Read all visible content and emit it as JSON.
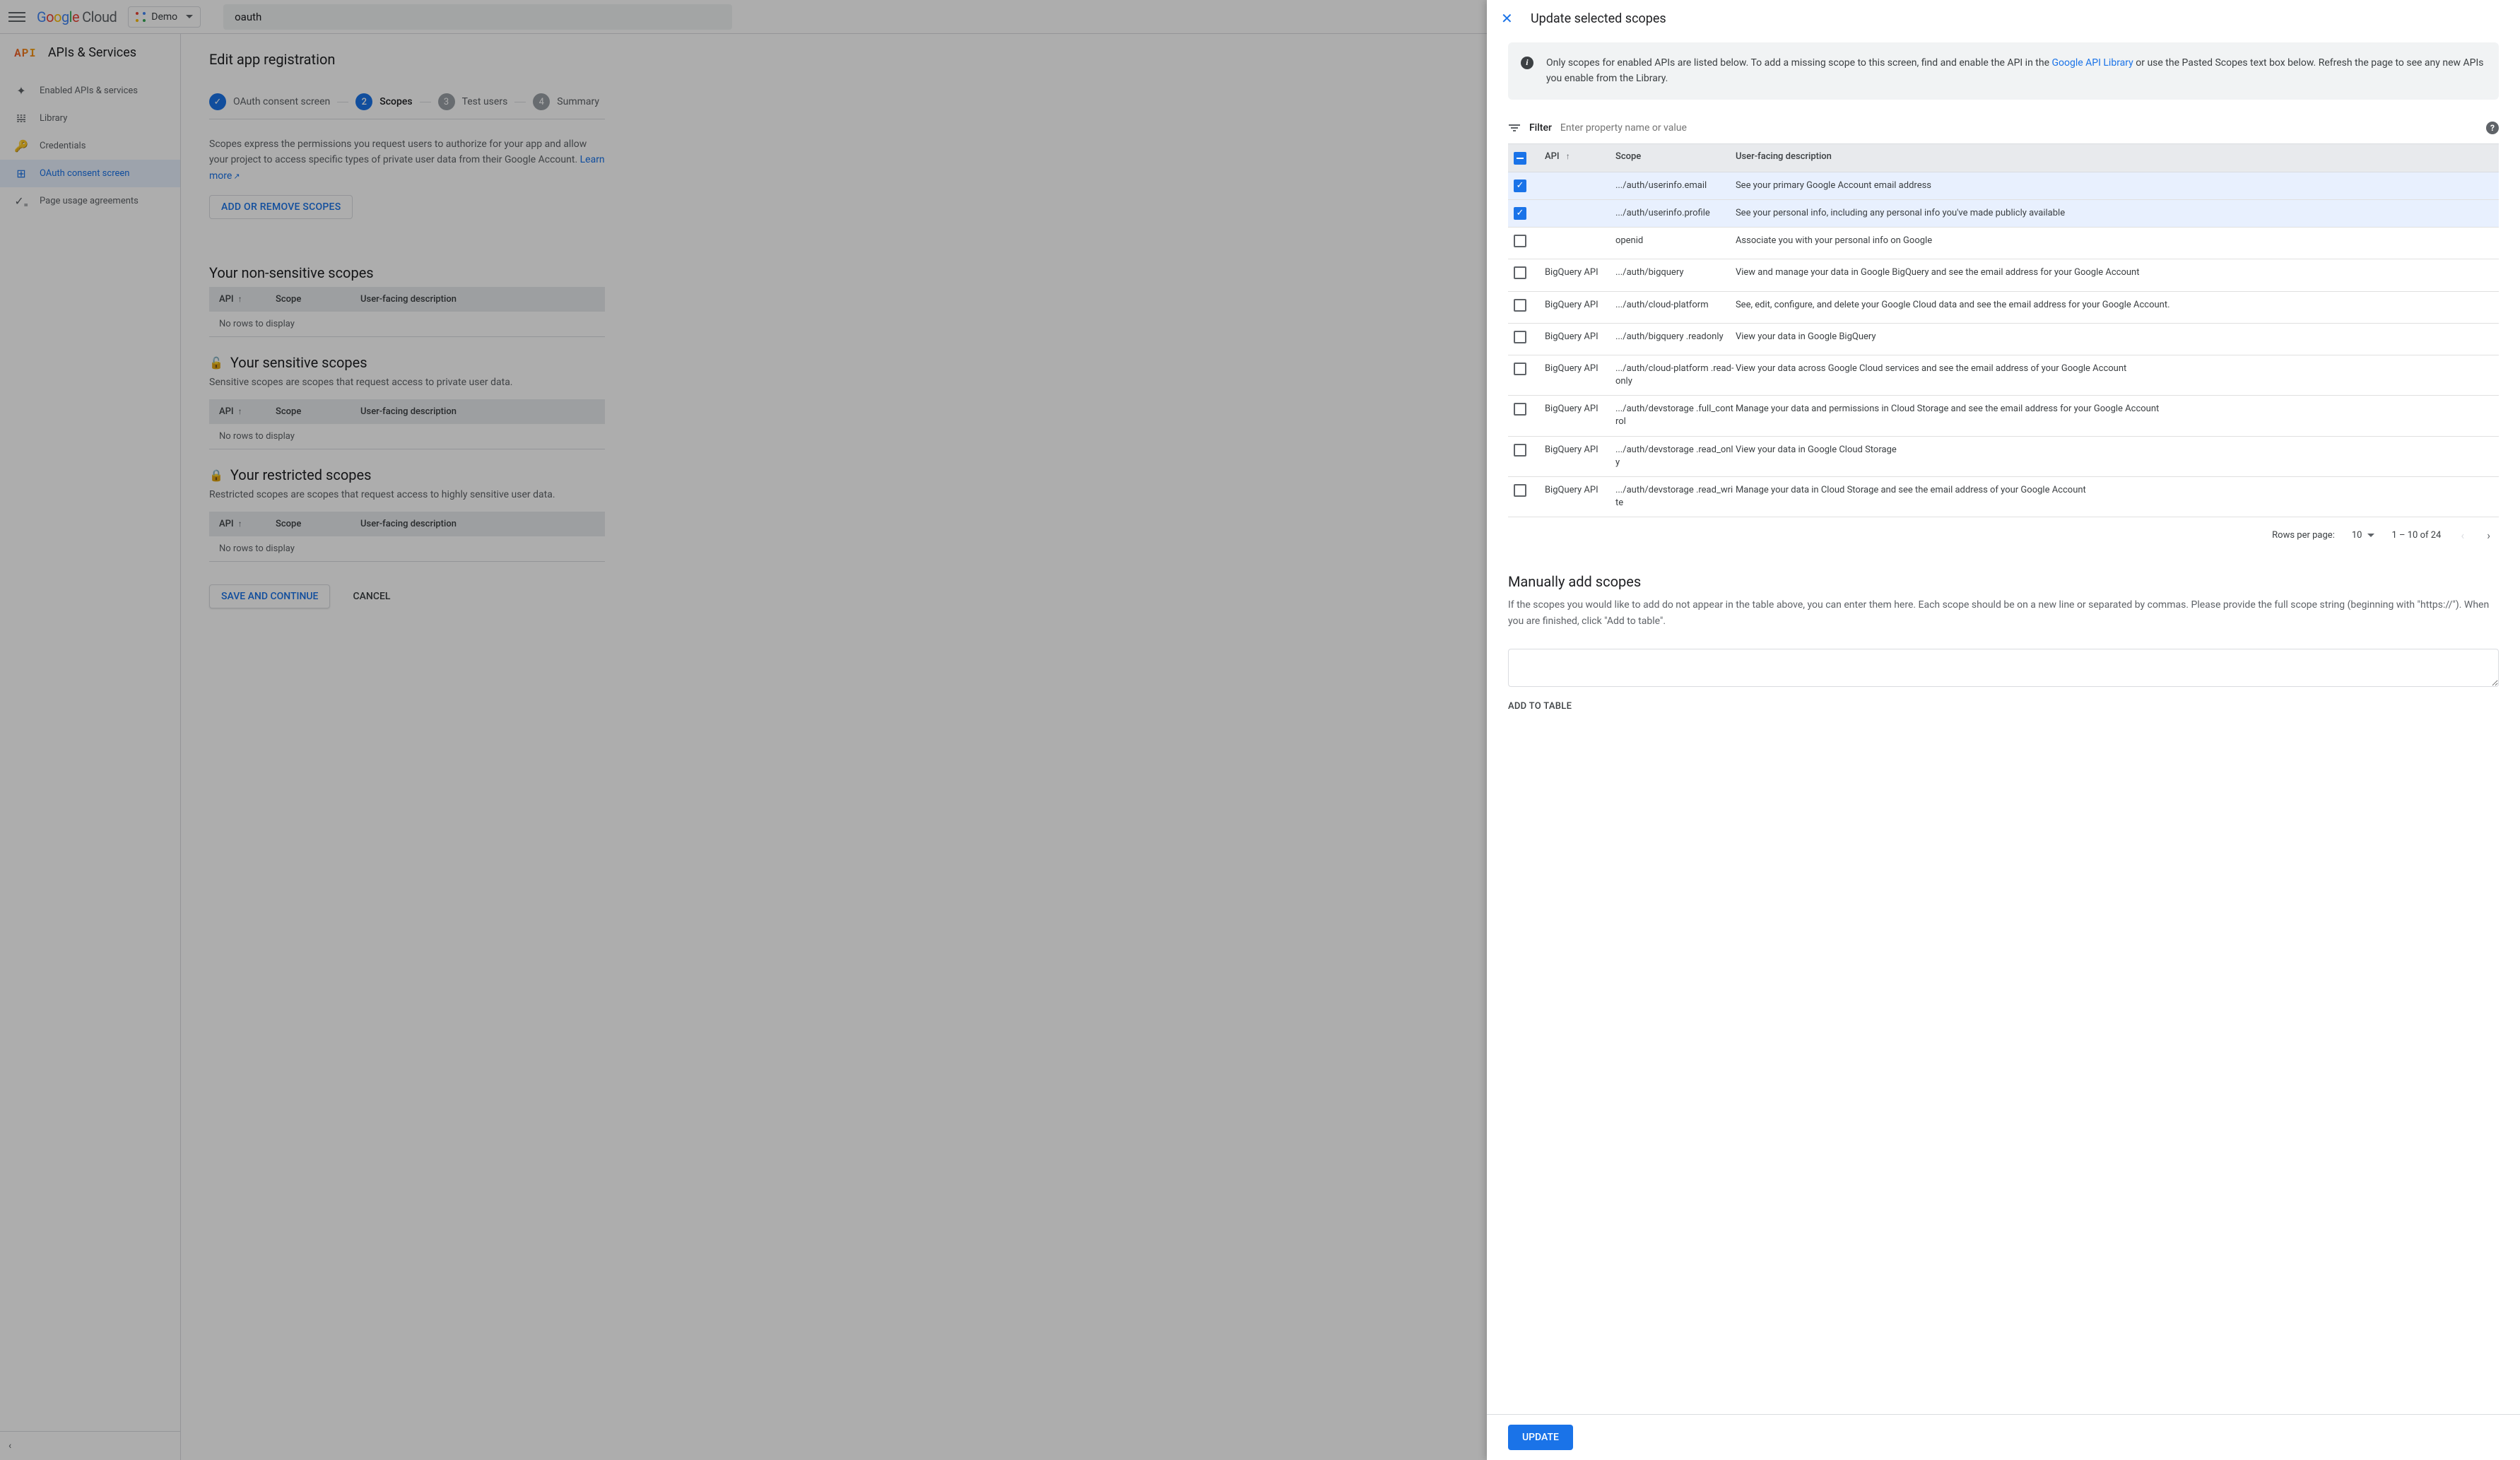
{
  "topbar": {
    "logo_cloud_text": "Cloud",
    "project_label": "Demo",
    "search_value": "oauth"
  },
  "sidebar": {
    "section_title": "APIs & Services",
    "items": [
      {
        "icon": "✦",
        "label": "Enabled APIs & services"
      },
      {
        "icon": "𝍐",
        "label": "Library"
      },
      {
        "icon": "🔑",
        "label": "Credentials"
      },
      {
        "icon": "⊞",
        "label": "OAuth consent screen"
      },
      {
        "icon": "✓₌",
        "label": "Page usage agreements"
      }
    ]
  },
  "content": {
    "page_title": "Edit app registration",
    "steps": [
      {
        "label": "OAuth consent screen"
      },
      {
        "num": "2",
        "label": "Scopes"
      },
      {
        "num": "3",
        "label": "Test users"
      },
      {
        "num": "4",
        "label": "Summary"
      }
    ],
    "intro_text": "Scopes express the permissions you request users to authorize for your app and allow your project to access specific types of private user data from their Google Account. ",
    "learn_more": "Learn more",
    "add_remove_btn": "ADD OR REMOVE SCOPES",
    "tables": {
      "col_api": "API",
      "col_scope": "Scope",
      "col_desc": "User-facing description",
      "no_rows": "No rows to display"
    },
    "non_sensitive_title": "Your non-sensitive scopes",
    "sensitive_title": "Your sensitive scopes",
    "sensitive_desc": "Sensitive scopes are scopes that request access to private user data.",
    "restricted_title": "Your restricted scopes",
    "restricted_desc": "Restricted scopes are scopes that request access to highly sensitive user data.",
    "save_btn": "SAVE AND CONTINUE",
    "cancel_btn": "CANCEL"
  },
  "panel": {
    "title": "Update selected scopes",
    "info_text_pre": "Only scopes for enabled APIs are listed below. To add a missing scope to this screen, find and enable the API in the ",
    "info_link": "Google API Library",
    "info_text_post": " or use the Pasted Scopes text box below. Refresh the page to see any new APIs you enable from the Library.",
    "filter_label": "Filter",
    "filter_placeholder": "Enter property name or value",
    "cols": {
      "api": "API",
      "scope": "Scope",
      "desc": "User-facing description"
    },
    "rows": [
      {
        "selected": true,
        "api": "",
        "scope": ".../auth/userinfo.email",
        "desc": "See your primary Google Account email address"
      },
      {
        "selected": true,
        "api": "",
        "scope": ".../auth/userinfo.profile",
        "desc": "See your personal info, including any personal info you've made publicly available"
      },
      {
        "selected": false,
        "api": "",
        "scope": "openid",
        "desc": "Associate you with your personal info on Google"
      },
      {
        "selected": false,
        "api": "BigQuery API",
        "scope": ".../auth/bigquery",
        "desc": "View and manage your data in Google BigQuery and see the email address for your Google Account"
      },
      {
        "selected": false,
        "api": "BigQuery API",
        "scope": ".../auth/cloud-platform",
        "desc": "See, edit, configure, and delete your Google Cloud data and see the email address for your Google Account."
      },
      {
        "selected": false,
        "api": "BigQuery API",
        "scope": ".../auth/bigquery .readonly",
        "desc": "View your data in Google BigQuery"
      },
      {
        "selected": false,
        "api": "BigQuery API",
        "scope": ".../auth/cloud-platform .read-only",
        "desc": "View your data across Google Cloud services and see the email address of your Google Account"
      },
      {
        "selected": false,
        "api": "BigQuery API",
        "scope": ".../auth/devstorage .full_control",
        "desc": "Manage your data and permissions in Cloud Storage and see the email address for your Google Account"
      },
      {
        "selected": false,
        "api": "BigQuery API",
        "scope": ".../auth/devstorage .read_only",
        "desc": "View your data in Google Cloud Storage"
      },
      {
        "selected": false,
        "api": "BigQuery API",
        "scope": ".../auth/devstorage .read_write",
        "desc": "Manage your data in Cloud Storage and see the email address of your Google Account"
      }
    ],
    "pager": {
      "rpp_label": "Rows per page:",
      "rpp_value": "10",
      "range": "1 – 10 of 24"
    },
    "manual_title": "Manually add scopes",
    "manual_desc": "If the scopes you would like to add do not appear in the table above, you can enter them here. Each scope should be on a new line or separated by commas. Please provide the full scope string (beginning with \"https://\"). When you are finished, click \"Add to table\".",
    "add_to_table_btn": "ADD TO TABLE",
    "update_btn": "UPDATE"
  }
}
